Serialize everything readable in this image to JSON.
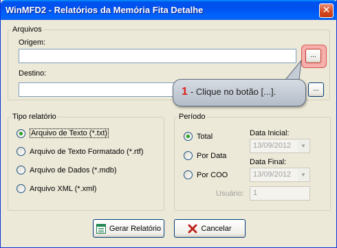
{
  "window": {
    "title": "WinMFD2 - Relatórios da Memória Fita Detalhe",
    "close_glyph": "✕"
  },
  "arquivos": {
    "legend": "Arquivos",
    "origem_label": "Origem:",
    "origem_value": "",
    "destino_label": "Destino:",
    "destino_value": "",
    "browse_label": "..."
  },
  "tipo": {
    "legend": "Tipo relatório",
    "options": [
      {
        "label": "Arquivo de Texto (*.txt)",
        "selected": true
      },
      {
        "label": "Arquivo de Texto Formatado (*.rtf)",
        "selected": false
      },
      {
        "label": "Arquivo de Dados (*.mdb)",
        "selected": false
      },
      {
        "label": "Arquivo XML (*.xml)",
        "selected": false
      }
    ]
  },
  "periodo": {
    "legend": "Período",
    "options": [
      {
        "label": "Total",
        "selected": true
      },
      {
        "label": "Por Data",
        "selected": false
      },
      {
        "label": "Por COO",
        "selected": false
      }
    ],
    "data_inicial_label": "Data Inicial:",
    "data_inicial_value": "13/09/2012",
    "data_final_label": "Data Final:",
    "data_final_value": "13/09/2012",
    "usuario_label": "Usuário:",
    "usuario_value": "1"
  },
  "buttons": {
    "gerar": "Gerar Relatório",
    "cancelar": "Cancelar"
  },
  "callout": {
    "number": "1",
    "text": "- Clique no botão [...]."
  },
  "colors": {
    "title_bar": "#0053ee",
    "callout_number": "#e01f1f",
    "highlight": "#f6b1ac"
  }
}
